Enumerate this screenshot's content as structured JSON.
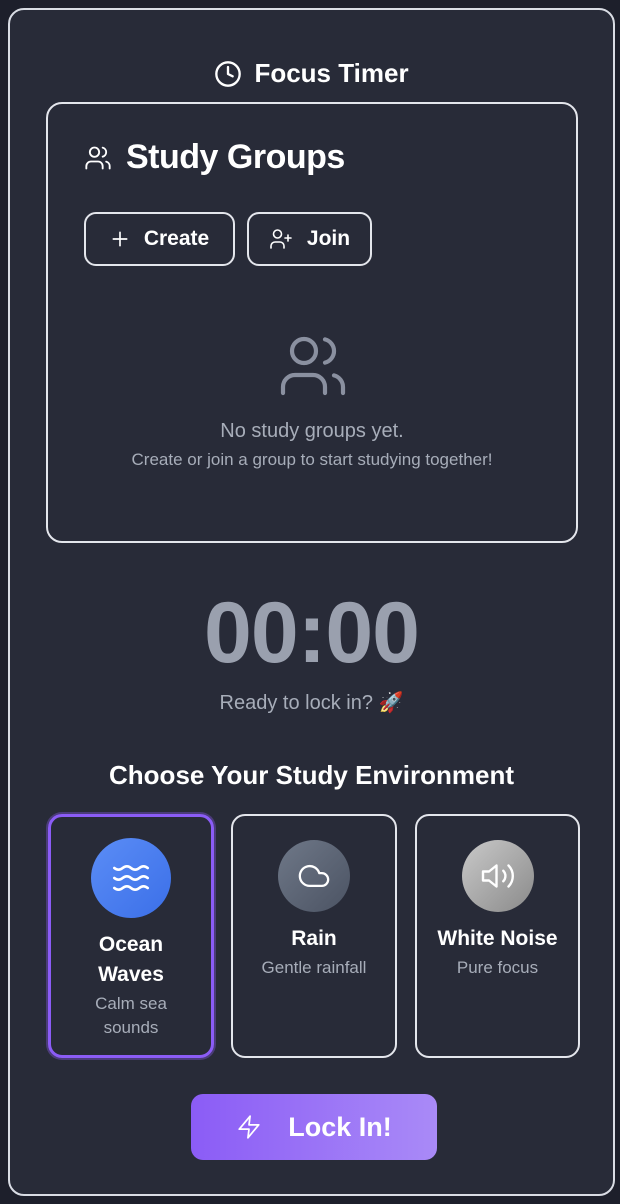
{
  "header": {
    "title": "Focus Timer",
    "icon": "clock-icon"
  },
  "study_groups": {
    "title": "Study Groups",
    "create_label": "Create",
    "join_label": "Join",
    "empty_title": "No study groups yet.",
    "empty_subtitle": "Create or join a group to start studying together!"
  },
  "timer": {
    "display": "00:00",
    "status": "Ready to lock in? 🚀"
  },
  "environments": {
    "heading": "Choose Your Study Environment",
    "selected": "Ocean Waves",
    "items": [
      {
        "name": "Ocean Waves",
        "description": "Calm sea sounds",
        "icon": "waves-icon",
        "color": "#4a7ef0"
      },
      {
        "name": "Rain",
        "description": "Gentle rainfall",
        "icon": "cloud-icon",
        "color": "#5c6474"
      },
      {
        "name": "White Noise",
        "description": "Pure focus",
        "icon": "speaker-icon",
        "color": "#a8a8a8"
      }
    ]
  },
  "action": {
    "lock_in_label": "Lock In!",
    "icon": "lightning-icon"
  },
  "colors": {
    "accent": "#8b5cf6",
    "panel_bg": "#282b38",
    "muted_text": "#a7adb9"
  }
}
